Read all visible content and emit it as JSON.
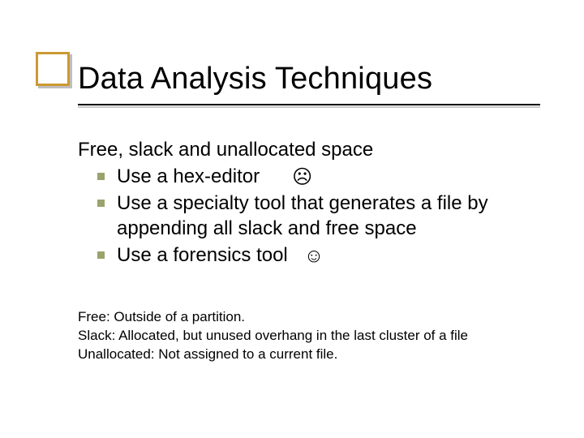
{
  "title": "Data Analysis Techniques",
  "lead": "Free, slack and unallocated space",
  "bullets": [
    {
      "text": "Use a hex-editor",
      "emoji": "☹"
    },
    {
      "text": "Use a specialty tool that generates a file by appending all slack and free space",
      "emoji": ""
    },
    {
      "text": "Use a forensics tool",
      "emoji": "☺"
    }
  ],
  "definitions": [
    "Free: Outside of a partition.",
    "Slack: Allocated, but unused overhang in the last cluster of a file",
    "Unallocated: Not assigned to a current file."
  ]
}
